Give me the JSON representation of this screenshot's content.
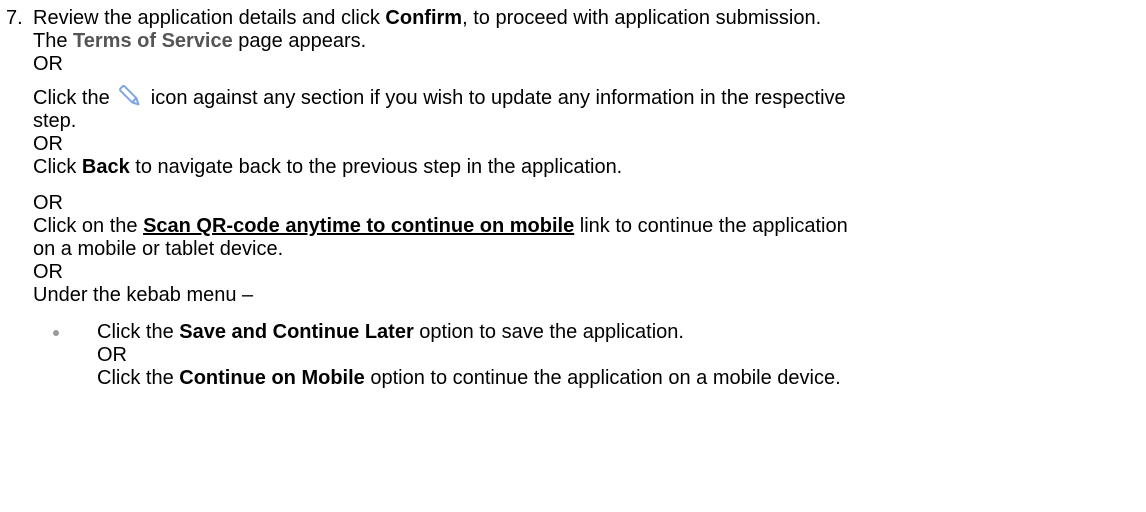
{
  "step": {
    "number": "7.",
    "p1_a": "Review the application details and click ",
    "p1_confirm": "Confirm",
    "p1_b": ", to proceed with application submission.",
    "p2_a": "The ",
    "p2_tos": "Terms of Service",
    "p2_b": " page appears.",
    "or1": "OR",
    "p3_a": "Click the ",
    "p3_b": " icon against any section if you wish to update any information in the respective",
    "p3_c": "step.",
    "or2": "OR",
    "p4_a": "Click ",
    "p4_back": "Back",
    "p4_b": " to navigate back to the previous step in the application.",
    "or3": "OR",
    "p5_a": "Click on the ",
    "p5_link": "Scan QR-code anytime to continue on mobile",
    "p5_b": " link to continue the application",
    "p5_c": "on a mobile or tablet device.",
    "or4": "OR",
    "p6": "Under the kebab menu –",
    "bullet": {
      "a": "Click the ",
      "save": "Save and Continue Later",
      "b": " option to save the application.",
      "or": "OR",
      "c": "Click the ",
      "mobile": "Continue on Mobile",
      "d": " option to continue the application on a mobile device."
    },
    "icons": {
      "edit": "pencil-edit-icon"
    },
    "colors": {
      "text": "#000000",
      "terms_of_service": "#555555",
      "pencil_icon": "#7fa6e0",
      "bullet": "#9a9a9a"
    }
  }
}
